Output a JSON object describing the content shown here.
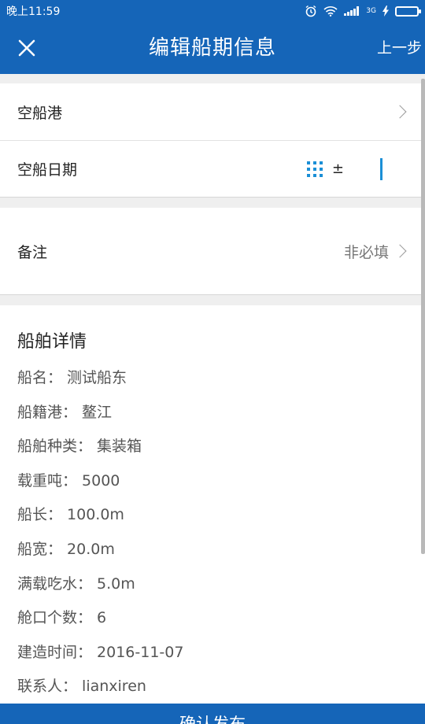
{
  "status_bar": {
    "time": "晚上11:59",
    "net_type": "3G"
  },
  "app_bar": {
    "title": "编辑船期信息",
    "prev_label": "上一步"
  },
  "form": {
    "port_label": "空船港",
    "date_label": "空船日期",
    "date_plusminus": "±",
    "remark_label": "备注",
    "remark_hint": "非必填"
  },
  "details": {
    "title": "船舶详情",
    "lines": [
      "船名： 测试船东",
      "船籍港： 鳌江",
      "船舶种类： 集装箱",
      "载重吨： 5000",
      "船长： 100.0m",
      "船宽： 20.0m",
      "满载吃水： 5.0m",
      "舱口个数： 6",
      "建造时间： 2016-11-07",
      "联系人： lianxiren"
    ]
  },
  "bottom_button": {
    "label": "确认发布"
  },
  "colors": {
    "primary": "#1565b8",
    "accent": "#1b8fd6",
    "battery": "#6bd33b"
  }
}
